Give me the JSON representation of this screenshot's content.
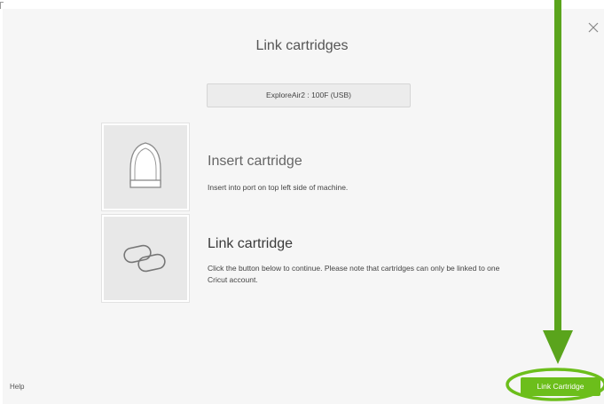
{
  "dialog": {
    "title": "Link cartridges",
    "close_icon": "close-icon",
    "machine": "ExploreAir2 : 100F (USB)"
  },
  "steps": [
    {
      "icon": "cartridge-icon",
      "heading": "Insert cartridge",
      "description": "Insert into port on top left side of machine."
    },
    {
      "icon": "link-icon",
      "heading": "Link cartridge",
      "description": "Click the button below to continue. Please note that cartridges can only be linked to one Cricut account."
    }
  ],
  "footer": {
    "help_label": "Help",
    "link_button_label": "Link Cartridge"
  },
  "colors": {
    "accent": "#6cbe1b",
    "annotation": "#5aa41c",
    "background": "#f6f6f6"
  }
}
